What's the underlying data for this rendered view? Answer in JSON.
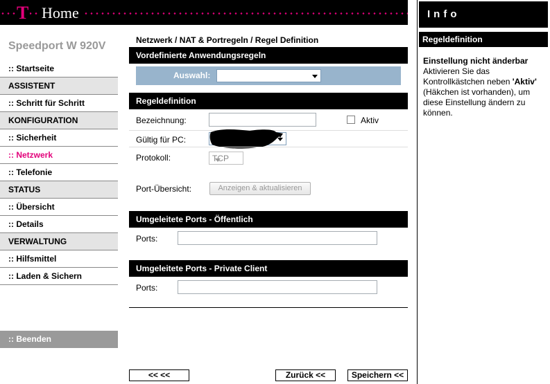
{
  "header": {
    "logo": "T",
    "brand": "Home"
  },
  "device": {
    "name": "Speedport W 920V"
  },
  "nav": [
    {
      "label": ":: Startseite",
      "kind": "link"
    },
    {
      "label": "ASSISTENT",
      "kind": "section"
    },
    {
      "label": ":: Schritt für Schritt",
      "kind": "link"
    },
    {
      "label": "KONFIGURATION",
      "kind": "section"
    },
    {
      "label": ":: Sicherheit",
      "kind": "link"
    },
    {
      "label": ":: Netzwerk",
      "kind": "active"
    },
    {
      "label": ":: Telefonie",
      "kind": "link"
    },
    {
      "label": "STATUS",
      "kind": "section"
    },
    {
      "label": ":: Übersicht",
      "kind": "link"
    },
    {
      "label": ":: Details",
      "kind": "link"
    },
    {
      "label": "VERWALTUNG",
      "kind": "section"
    },
    {
      "label": ":: Hilfsmittel",
      "kind": "link"
    },
    {
      "label": ":: Laden & Sichern",
      "kind": "link"
    }
  ],
  "logout": ":: Beenden",
  "breadcrumb": "Netzwerk / NAT & Portregeln / Regel Definition",
  "sections": {
    "predefined": "Vordefinierte Anwendungsregeln",
    "rule": "Regeldefinition",
    "public_ports": "Umgeleitete Ports - Öffentlich",
    "private_ports": "Umgeleitete Ports - Private Client"
  },
  "form": {
    "auswahl_label": "Auswahl:",
    "auswahl_value": "",
    "bezeichnung_label": "Bezeichnung:",
    "bezeichnung_value": "",
    "aktiv_label": "Aktiv",
    "aktiv_checked": false,
    "pc_label": "Gültig für PC:",
    "protokoll_label": "Protokoll:",
    "protokoll_value": "TCP",
    "port_overview_label": "Port-Übersicht:",
    "port_overview_button": "Anzeigen & aktualisieren",
    "ports_label": "Ports:",
    "public_ports_value": "",
    "private_ports_value": ""
  },
  "buttons": {
    "back_all": "<<  <<",
    "back": "Zurück <<",
    "save": "Speichern <<"
  },
  "info": {
    "header": "Info",
    "title": "Regeldefinition",
    "heading": "Einstellung nicht änderbar",
    "text_before": "Aktivieren Sie das Kontrollkästchen neben ",
    "text_bold": "'Aktiv'",
    "text_after": " (Häkchen ist vorhanden), um diese Einstellung ändern zu können."
  },
  "colors": {
    "magenta": "#e2007a",
    "panel_blue": "#98b4cc",
    "section_gray": "#e4e4e4"
  }
}
